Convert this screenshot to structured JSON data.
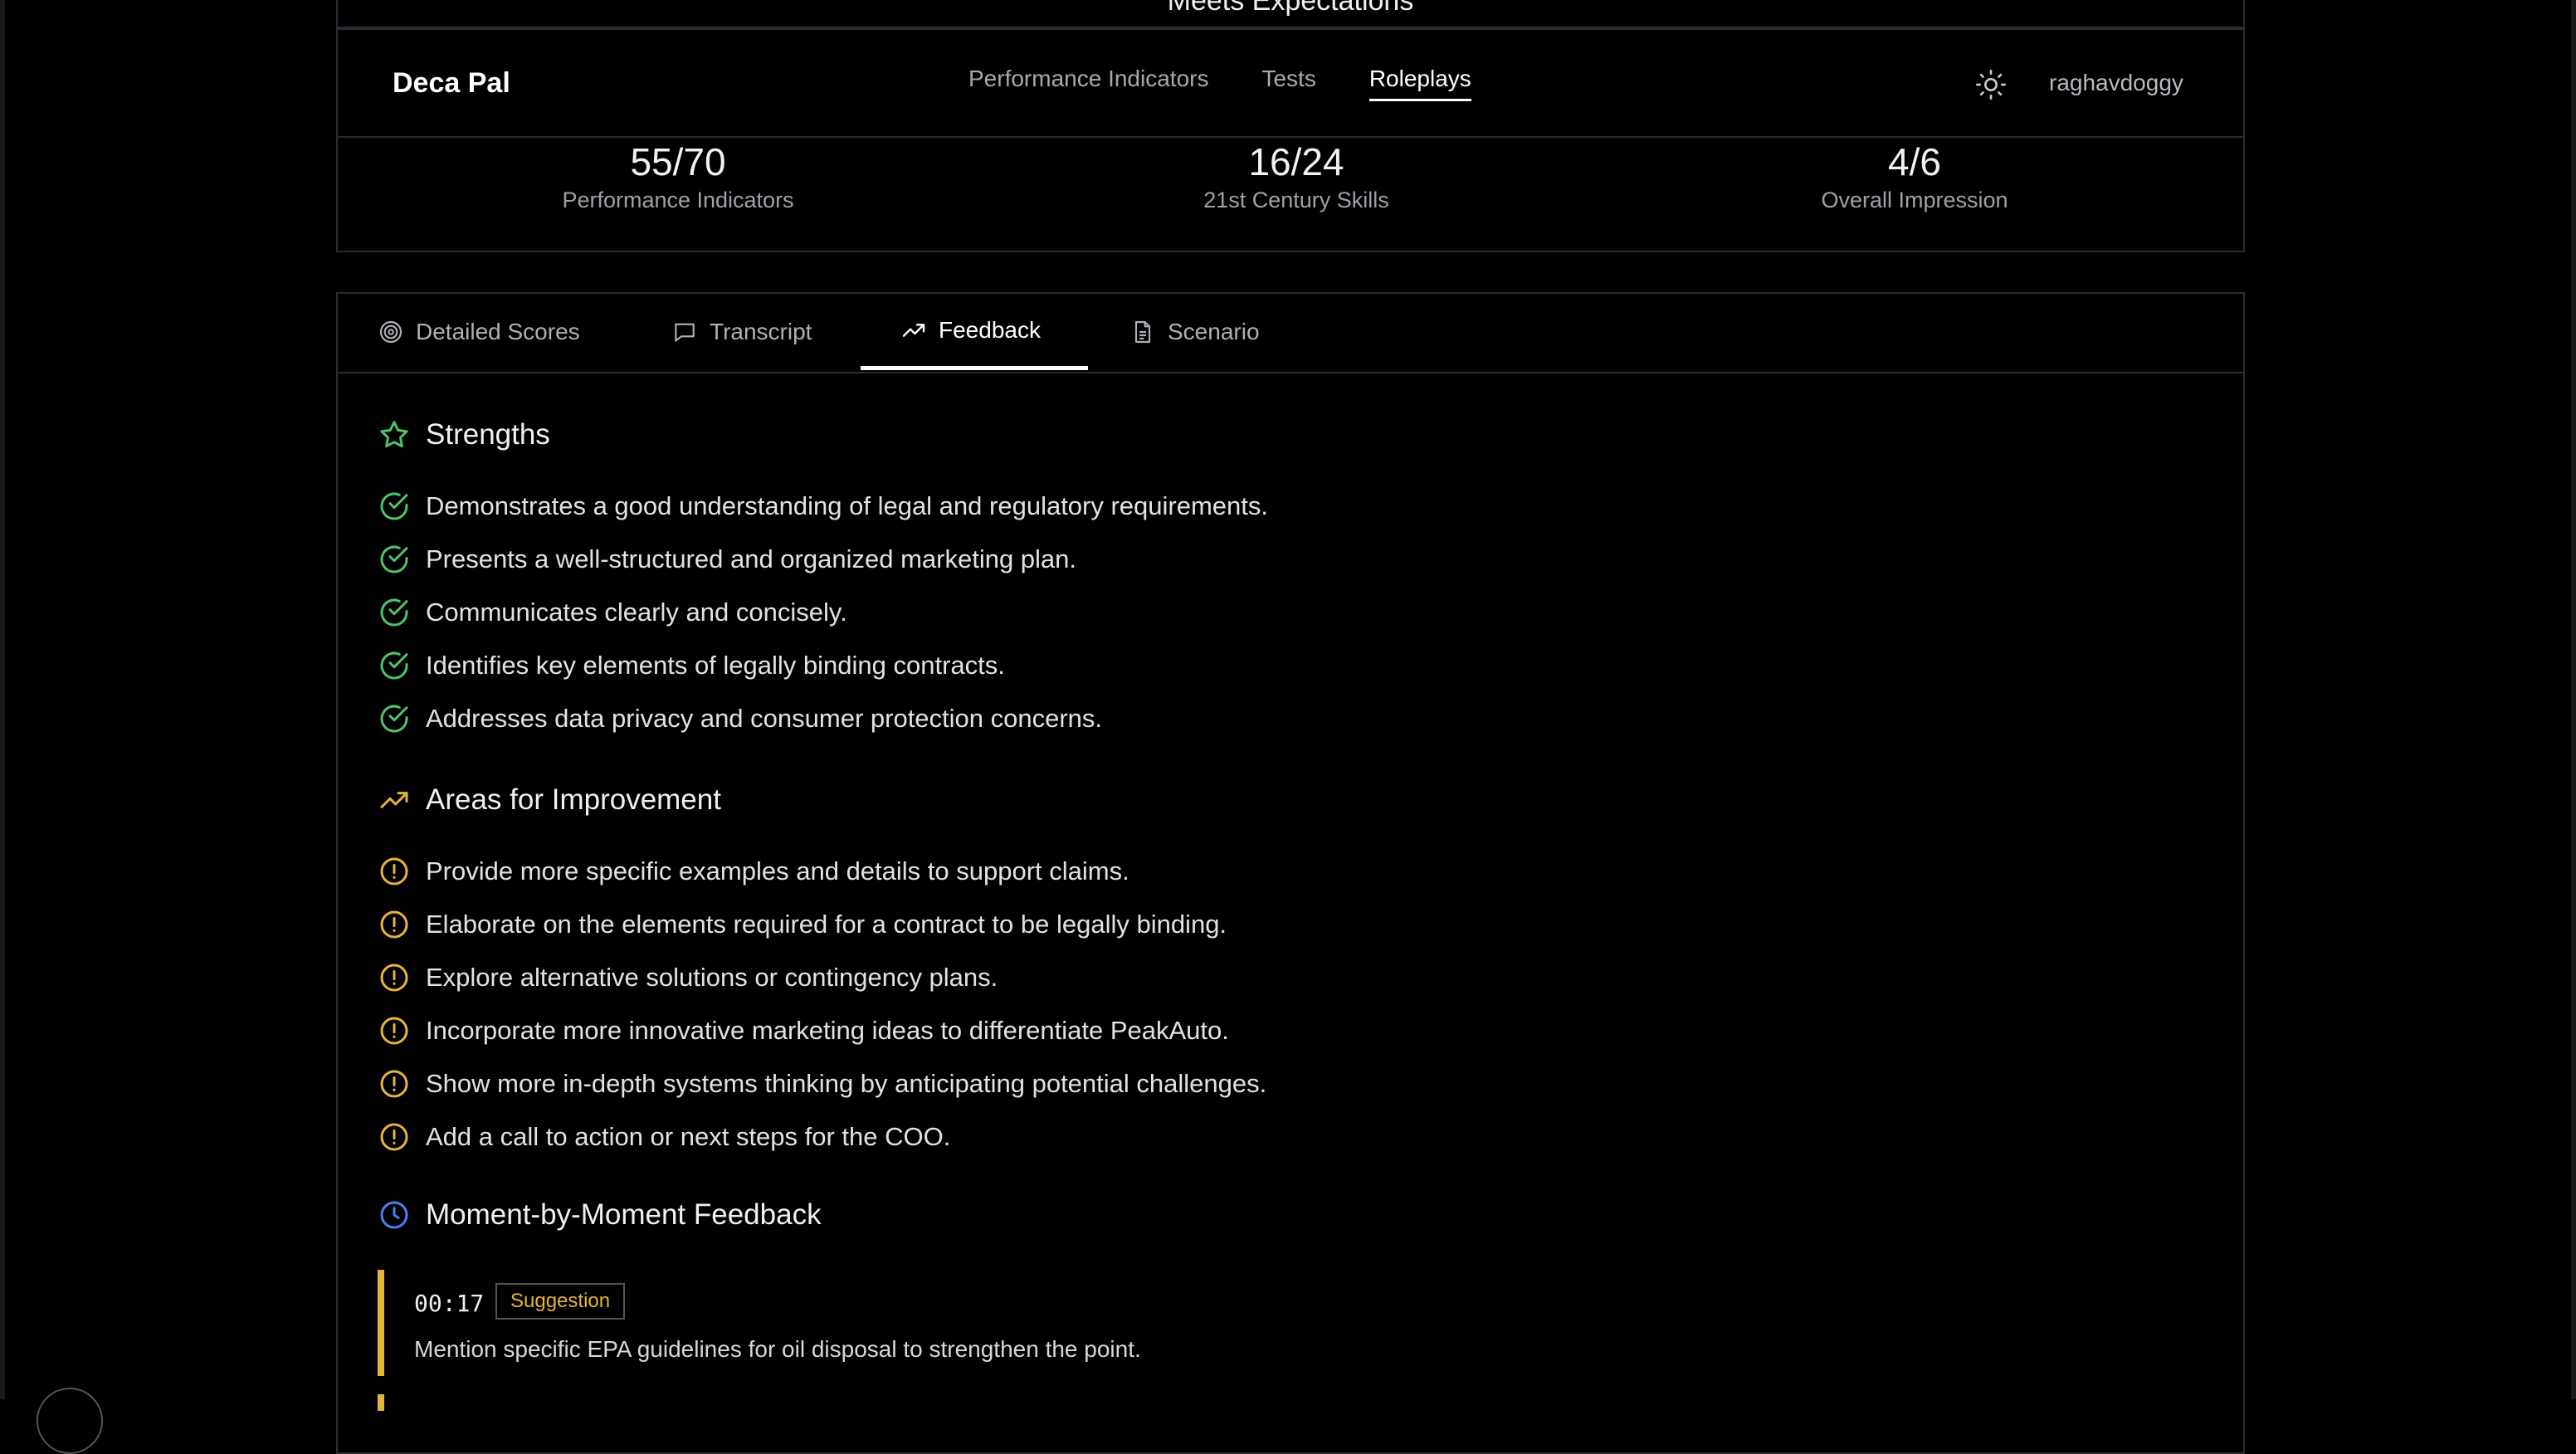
{
  "top_card": {
    "cut_text": "Meets Expectations"
  },
  "navbar": {
    "brand": "Deca Pal",
    "links": [
      "Performance Indicators",
      "Tests",
      "Roleplays"
    ],
    "active_link": "Roleplays",
    "theme_icon": "sun-icon",
    "username": "raghavdoggy"
  },
  "scores": [
    {
      "value": "55/70",
      "label": "Performance Indicators"
    },
    {
      "value": "16/24",
      "label": "21st Century Skills"
    },
    {
      "value": "4/6",
      "label": "Overall Impression"
    }
  ],
  "tabs": [
    {
      "label": "Detailed Scores",
      "icon": "target-icon"
    },
    {
      "label": "Transcript",
      "icon": "message-icon"
    },
    {
      "label": "Feedback",
      "icon": "trending-up-icon",
      "active": true
    },
    {
      "label": "Scenario",
      "icon": "document-icon"
    }
  ],
  "strengths": {
    "title": "Strengths",
    "items": [
      "Demonstrates a good understanding of legal and regulatory requirements.",
      "Presents a well-structured and organized marketing plan.",
      "Communicates clearly and concisely.",
      "Identifies key elements of legally binding contracts.",
      "Addresses data privacy and consumer protection concerns."
    ]
  },
  "improvements": {
    "title": "Areas for Improvement",
    "items": [
      "Provide more specific examples and details to support claims.",
      "Elaborate on the elements required for a contract to be legally binding.",
      "Explore alternative solutions or contingency plans.",
      "Incorporate more innovative marketing ideas to differentiate PeakAuto.",
      "Show more in-depth systems thinking by anticipating potential challenges.",
      "Add a call to action or next steps for the COO."
    ]
  },
  "moments": {
    "title": "Moment-by-Moment Feedback",
    "items": [
      {
        "time": "00:17",
        "badge": "Suggestion",
        "text": "Mention specific EPA guidelines for oil disposal to strengthen the point."
      }
    ]
  },
  "colors": {
    "green": "#4fc26b",
    "amber": "#e5b53a",
    "blue": "#4f7df0",
    "border": "#2b2b33"
  }
}
